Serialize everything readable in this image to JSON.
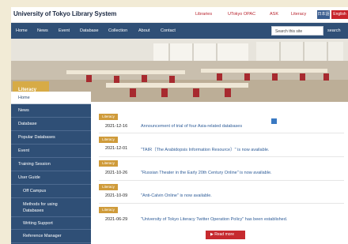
{
  "header": {
    "title": "University of Tokyo Library System",
    "links": [
      "Libraries",
      "UTokyo OPAC",
      "ASK",
      "Literacy"
    ],
    "lang_ja": "日本語",
    "lang_en": "English"
  },
  "nav": {
    "items": [
      "Home",
      "News",
      "Event",
      "Database",
      "Collection",
      "About",
      "Contact"
    ],
    "search_placeholder": "Search this site",
    "search_button": "search"
  },
  "hero": {
    "title": "Literacy"
  },
  "sidebar": {
    "items": [
      "Home",
      "News",
      "Database",
      "Popular Databases",
      "Event",
      "Training Session",
      "User Guide",
      "Off Campus",
      "Methods for using",
      "Databases",
      "Writing Support",
      "Reference Manager"
    ]
  },
  "news": {
    "badge": "Literacy",
    "items": [
      {
        "date": "2021-12-16",
        "title": "Announcement of trial of four Asia-related databases"
      },
      {
        "date": "2021-12-01",
        "title": "\"TAIR（The Arabidopsis Information Resource）\" is now available."
      },
      {
        "date": "2021-10-26",
        "title": "\"Russian Theater in the Early 20th Century Online\" is now available."
      },
      {
        "date": "2021-10-09",
        "title": "\"Anti-Calvin Online\" is now available."
      },
      {
        "date": "2021-06-29",
        "title": "\"University of Tokyo Literacy Twitter Operation Policy\" has been established."
      }
    ],
    "read_more": "Read more"
  }
}
